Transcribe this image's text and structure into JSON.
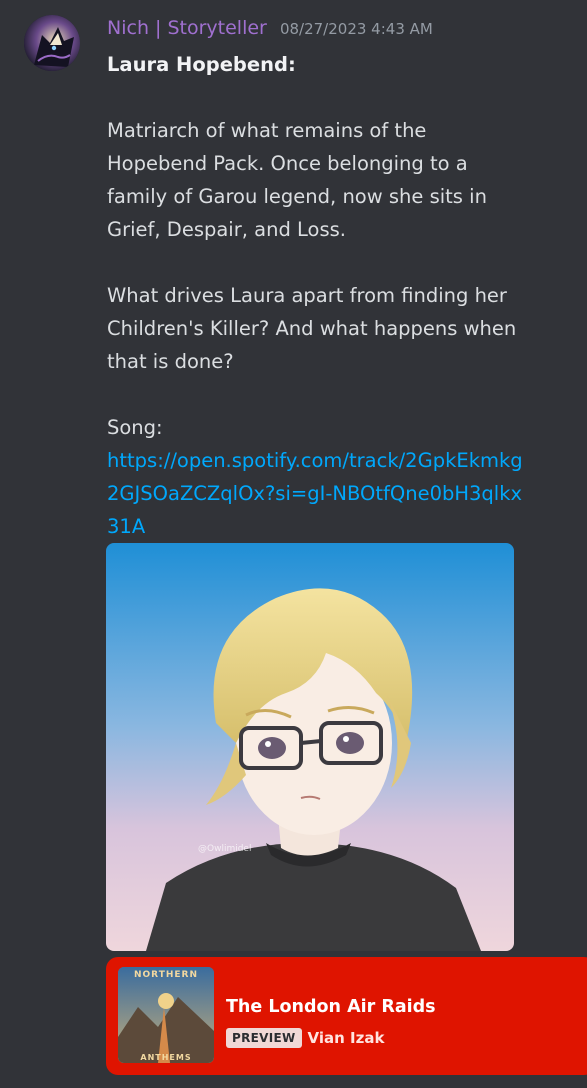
{
  "message": {
    "username": "Nich | Storyteller",
    "timestamp": "08/27/2023 4:43 AM",
    "avatar_icon": "wolf-avatar-icon",
    "lines": {
      "heading": "Laura Hopebend:",
      "para1": "Matriarch of what remains of the Hopebend Pack. Once belonging to a family of Garou legend, now she sits in Grief, Despair, and Loss.",
      "para2": "What drives Laura apart from finding her Children's Killer? And what happens when that is done?",
      "song_label": "Song:",
      "link": "https://open.spotify.com/track/2GpkEkmkg2GJSOaZCZqlOx?si=gI-NBOtfQne0bH3qlkx31A"
    },
    "image_watermark": "@Owlimidel"
  },
  "spotify_embed": {
    "color": "#df1400",
    "cover_text_top": "NORTHERN",
    "cover_text_bottom": "ANTHEMS",
    "title": "The London Air Raids",
    "badge": "PREVIEW",
    "artist": "Vian Izak"
  }
}
